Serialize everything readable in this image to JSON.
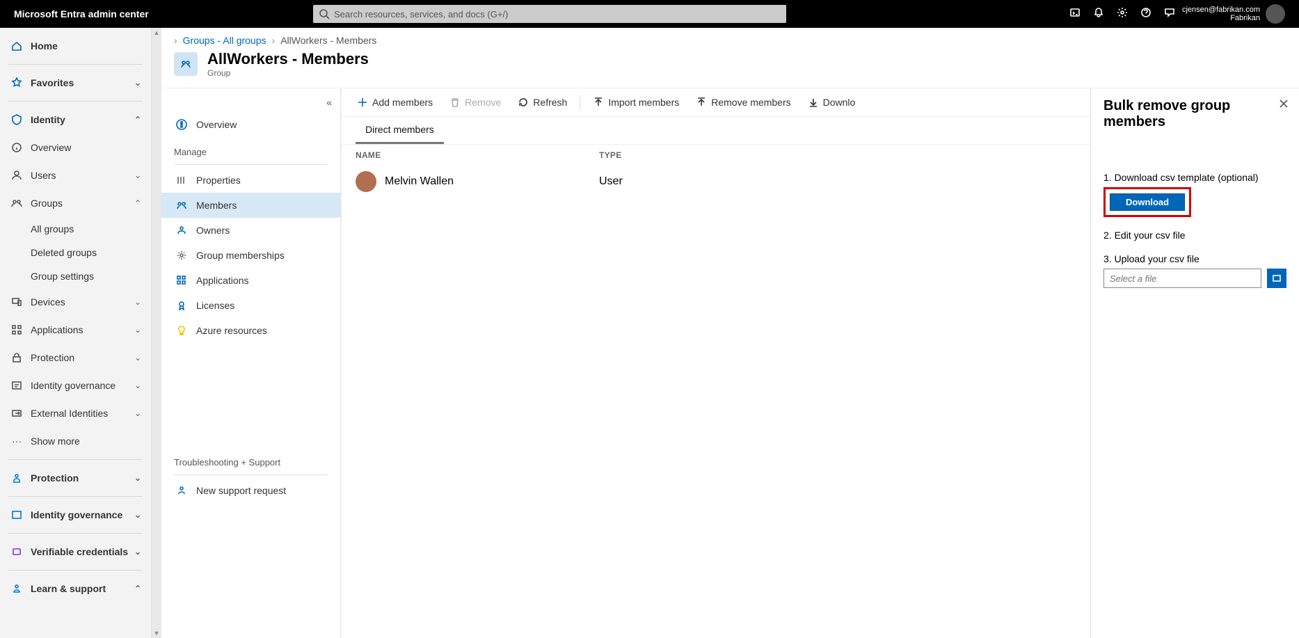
{
  "header": {
    "brand": "Microsoft Entra admin center",
    "search_placeholder": "Search resources, services, and docs (G+/)",
    "account_email": "cjensen@fabrikan.com",
    "account_tenant": "Fabrikan"
  },
  "left_nav": {
    "home": "Home",
    "favorites": "Favorites",
    "identity": "Identity",
    "identity_items": {
      "overview": "Overview",
      "users": "Users",
      "groups": "Groups",
      "groups_sub": {
        "all_groups": "All groups",
        "deleted_groups": "Deleted groups",
        "group_settings": "Group settings"
      },
      "devices": "Devices",
      "applications": "Applications",
      "protection": "Protection",
      "identity_governance": "Identity governance",
      "external_identities": "External Identities",
      "show_more": "Show more"
    },
    "protection": "Protection",
    "identity_governance": "Identity governance",
    "verifiable_credentials": "Verifiable credentials",
    "learn_support": "Learn & support"
  },
  "resource_menu": {
    "overview": "Overview",
    "manage_label": "Manage",
    "properties": "Properties",
    "members": "Members",
    "owners": "Owners",
    "group_memberships": "Group memberships",
    "applications": "Applications",
    "licenses": "Licenses",
    "azure_resources": "Azure resources",
    "troubleshoot_label": "Troubleshooting + Support",
    "new_support_request": "New support request"
  },
  "breadcrumb": {
    "groups_all": "Groups - All groups",
    "current": "AllWorkers - Members"
  },
  "page": {
    "title": "AllWorkers - Members",
    "subtitle": "Group"
  },
  "toolbar": {
    "add_members": "Add members",
    "remove": "Remove",
    "refresh": "Refresh",
    "import_members": "Import members",
    "remove_members": "Remove members",
    "download_members": "Downlo"
  },
  "tabs": {
    "direct": "Direct members"
  },
  "table": {
    "col_name": "NAME",
    "col_type": "TYPE",
    "rows": [
      {
        "name": "Melvin Wallen",
        "type": "User"
      }
    ]
  },
  "panel": {
    "title": "Bulk remove group members",
    "step1": "1. Download csv template (optional)",
    "download": "Download",
    "step2": "2. Edit your csv file",
    "step3": "3. Upload your csv file",
    "file_placeholder": "Select a file"
  }
}
